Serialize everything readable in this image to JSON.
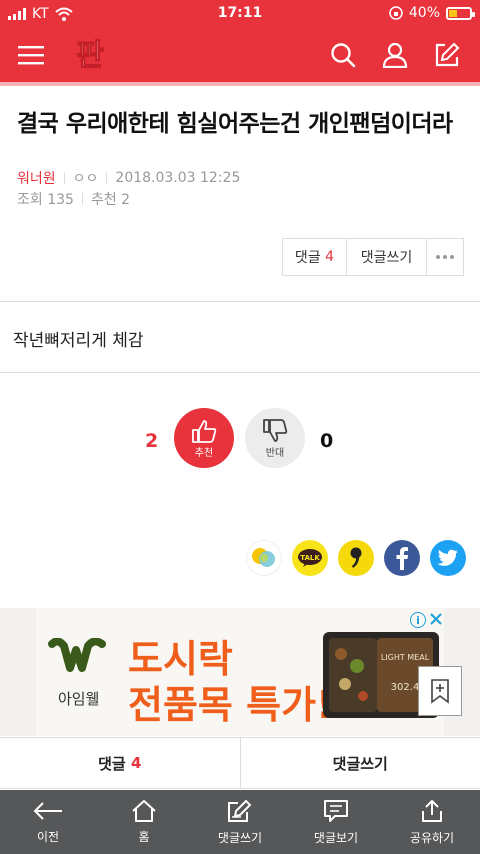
{
  "status_bar": {
    "carrier": "KT",
    "time": "17:11",
    "battery_percent": "40%",
    "battery_level": 0.4
  },
  "header": {
    "logo_text": "판",
    "icons": [
      "menu-icon",
      "search-icon",
      "user-icon",
      "edit-icon"
    ]
  },
  "article": {
    "title": "결국 우리애한테 힘실어주는건 개인팬덤이더라",
    "author": "워너원",
    "nickname": "ㅇㅇ",
    "datetime": "2018.03.03 12:25",
    "views": "조회 135",
    "recommend": "추천 2",
    "body": "작년뼈저리게 체감"
  },
  "actions": {
    "comment_label": "댓글",
    "comment_count": "4",
    "write_comment": "댓글쓰기"
  },
  "votes": {
    "up_count": "2",
    "up_label": "추천",
    "down_label": "반대",
    "down_count": "0"
  },
  "share": [
    "kakaostory-icon",
    "kakaotalk-icon",
    "comma-icon",
    "facebook-icon",
    "twitter-icon"
  ],
  "share_talk_label": "TALK",
  "ad": {
    "brand": "아임웰",
    "line1": "도시락",
    "line2": "전품목 특가!",
    "product_label": "LIGHT MEAL",
    "product_kcal": "302.4"
  },
  "comment_bar": {
    "comments_label": "댓글",
    "comments_count": "4",
    "write_label": "댓글쓰기"
  },
  "bottom_nav": {
    "back": "이전",
    "home": "홈",
    "write": "댓글쓰기",
    "view": "댓글보기",
    "share": "공유하기"
  },
  "colors": {
    "brand": "#e8323c",
    "twitter": "#1da1f2",
    "facebook": "#3b5998",
    "kakao": "#f7e317",
    "nav_bg": "#555759"
  }
}
